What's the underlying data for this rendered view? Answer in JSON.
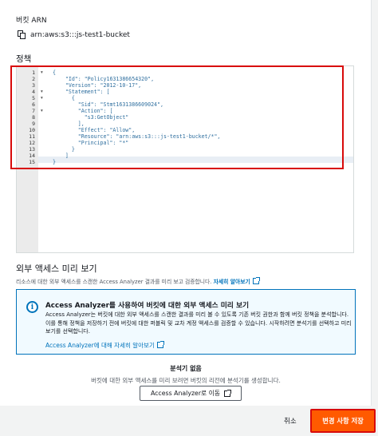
{
  "arn": {
    "label": "버킷 ARN",
    "value": "arn:aws:s3:::js-test1-bucket"
  },
  "policy": {
    "title": "정책",
    "line_numbers": [
      "1",
      "2",
      "3",
      "4",
      "5",
      "6",
      "7",
      "8",
      "9",
      "10",
      "11",
      "12",
      "13",
      "14",
      "15"
    ],
    "code_lines": [
      "{",
      "    \"Id\": \"Policy1631386654320\",",
      "    \"Version\": \"2012-10-17\",",
      "    \"Statement\": [",
      "      {",
      "        \"Sid\": \"Stmt1631386609024\",",
      "        \"Action\": [",
      "          \"s3:GetObject\"",
      "        ],",
      "        \"Effect\": \"Allow\",",
      "        \"Resource\": \"arn:aws:s3:::js-test1-bucket/*\",",
      "        \"Principal\": \"*\"",
      "      }",
      "    ]",
      "}"
    ]
  },
  "preview": {
    "title": "외부 액세스 미리 보기",
    "description": "리소스에 대한 외부 액세스를 스캔한 Access Analyzer 결과를 미리 보고 검증합니다.",
    "learn_more": "자세히 알아보기"
  },
  "info": {
    "icon": "info-icon",
    "title": "Access Analyzer를 사용하여 버킷에 대한 외부 액세스 미리 보기",
    "body": "Access Analyzer는 버킷에 대한 외부 액세스를 스캔한 결과를 미리 볼 수 있도록 기존 버킷 권한과 함께 버킷 정책을 분석합니다. 이를 통해 정책을 저장하기 전에 버킷에 대한 퍼블릭 및 교차 계정 액세스를 검증할 수 있습니다. 시작하려면 분석기를 선택하고 미리 보기를 선택합니다.",
    "link": "Access Analyzer에 대해 자세히 알아보기"
  },
  "empty": {
    "title": "분석기 없음",
    "description": "버킷에 대한 외부 액세스를 미리 보려면 버킷의 리전에 분석기를 생성합니다.",
    "button_label": "Access Analyzer로 이동"
  },
  "footer": {
    "cancel_label": "취소",
    "save_label": "변경 사항 저장"
  },
  "colors": {
    "accent": "#ff5a00",
    "link": "#0073bb",
    "highlight": "#d80a0a"
  }
}
